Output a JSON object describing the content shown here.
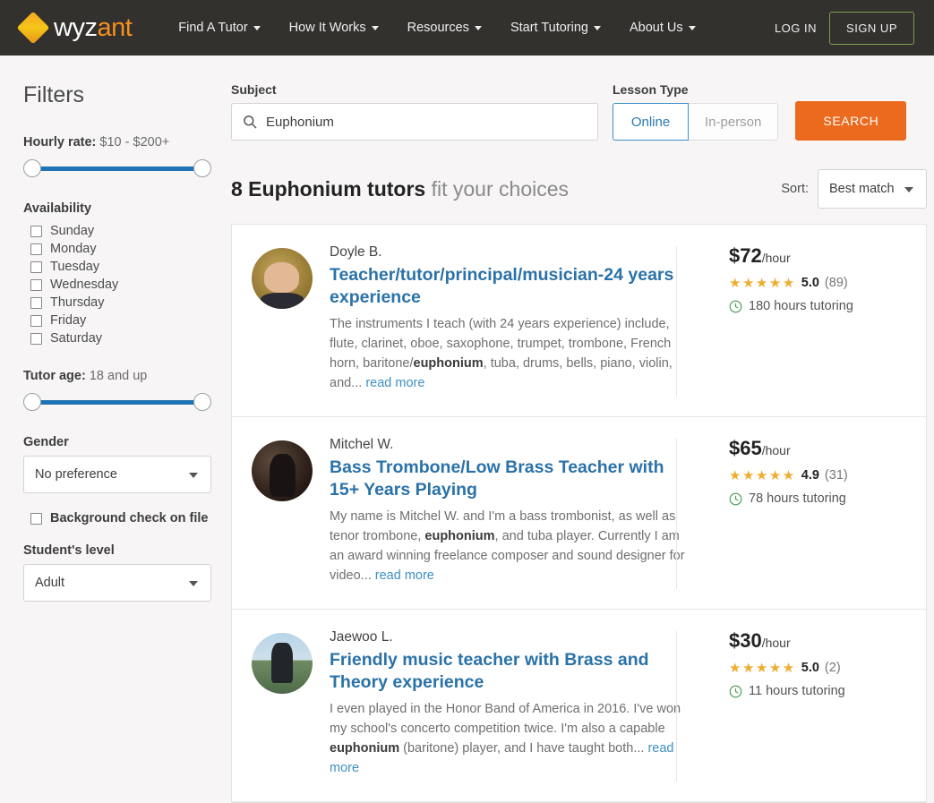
{
  "header": {
    "logo": {
      "part1": "wyz",
      "part2": "ant",
      "icon": "wyzant-diamond-logo"
    },
    "nav": [
      {
        "label": "Find A Tutor",
        "has_caret": true
      },
      {
        "label": "How It Works",
        "has_caret": true
      },
      {
        "label": "Resources",
        "has_caret": true
      },
      {
        "label": "Start Tutoring",
        "has_caret": true
      },
      {
        "label": "About Us",
        "has_caret": true
      }
    ],
    "login_label": "LOG IN",
    "signup_label": "SIGN UP",
    "bg_color": "#33312e",
    "signup_border_color": "#7d9b52",
    "logo_accent_color": "#f5901e"
  },
  "sidebar": {
    "title": "Filters",
    "hourly_rate": {
      "label": "Hourly rate:",
      "value": "$10 - $200+"
    },
    "availability": {
      "heading": "Availability",
      "days": [
        {
          "label": "Sunday",
          "checked": false
        },
        {
          "label": "Monday",
          "checked": false
        },
        {
          "label": "Tuesday",
          "checked": false
        },
        {
          "label": "Wednesday",
          "checked": false
        },
        {
          "label": "Thursday",
          "checked": false
        },
        {
          "label": "Friday",
          "checked": false
        },
        {
          "label": "Saturday",
          "checked": false
        }
      ]
    },
    "tutor_age": {
      "label": "Tutor age:",
      "value": "18 and up"
    },
    "gender": {
      "heading": "Gender",
      "selected": "No preference"
    },
    "background_check": {
      "label": "Background check on file",
      "checked": false
    },
    "student_level": {
      "heading": "Student's level",
      "selected": "Adult"
    },
    "slider_color": "#1d73b3"
  },
  "search": {
    "subject_label": "Subject",
    "subject_value": "Euphonium",
    "subject_icon": "search-icon",
    "lesson_type_label": "Lesson Type",
    "lesson_types": [
      {
        "label": "Online",
        "active": true
      },
      {
        "label": "In-person",
        "active": false
      }
    ],
    "search_button": "SEARCH",
    "search_button_color": "#ec6a1e",
    "active_toggle_color": "#2a7ab0"
  },
  "results": {
    "count_phrase": "8 Euphonium tutors",
    "suffix": " fit your choices",
    "sort_label": "Sort:",
    "sort_selected": "Best match",
    "link_color": "#2a72a8"
  },
  "tutors": [
    {
      "name": "Doyle B.",
      "headline": "Teacher/tutor/principal/musician-24 years experience",
      "bio_before": "The instruments I teach (with 24 years experience) include, flute, clarinet, oboe, saxophone, trumpet, trombone, French horn, baritone/",
      "bio_bold": "euphonium",
      "bio_after": ", tuba, drums, bells, piano, violin, and...",
      "read_more": "read more",
      "price": "$72",
      "price_unit": "/hour",
      "stars": "★★★★★",
      "rating": "5.0",
      "rating_count": "(89)",
      "hours": "180 hours tutoring",
      "avatar_name": "tutor-avatar-doyle-b"
    },
    {
      "name": "Mitchel W.",
      "headline": "Bass Trombone/Low Brass Teacher with 15+ Years Playing",
      "bio_before": "My name is Mitchel W. and I'm a bass trombonist, as well as tenor trombone, ",
      "bio_bold": "euphonium",
      "bio_after": ", and tuba player. Currently I am an award winning freelance composer and sound designer for video...",
      "read_more": "read more",
      "price": "$65",
      "price_unit": "/hour",
      "stars": "★★★★★",
      "rating": "4.9",
      "rating_count": "(31)",
      "hours": "78 hours tutoring",
      "avatar_name": "tutor-avatar-mitchel-w"
    },
    {
      "name": "Jaewoo L.",
      "headline": "Friendly music teacher with Brass and Theory experience",
      "bio_before": "I even played in the Honor Band of America in 2016. I've won my school's concerto competition twice. I'm also a capable ",
      "bio_bold": "euphonium",
      "bio_after": " (baritone) player, and I have taught both...",
      "read_more": "read more",
      "price": "$30",
      "price_unit": "/hour",
      "stars": "★★★★★",
      "rating": "5.0",
      "rating_count": "(2)",
      "hours": "11 hours tutoring",
      "avatar_name": "tutor-avatar-jaewoo-l"
    }
  ],
  "colors": {
    "page_bg": "#f7f5f5",
    "star_color": "#f0ad2e",
    "clock_color": "#4a9a53"
  }
}
